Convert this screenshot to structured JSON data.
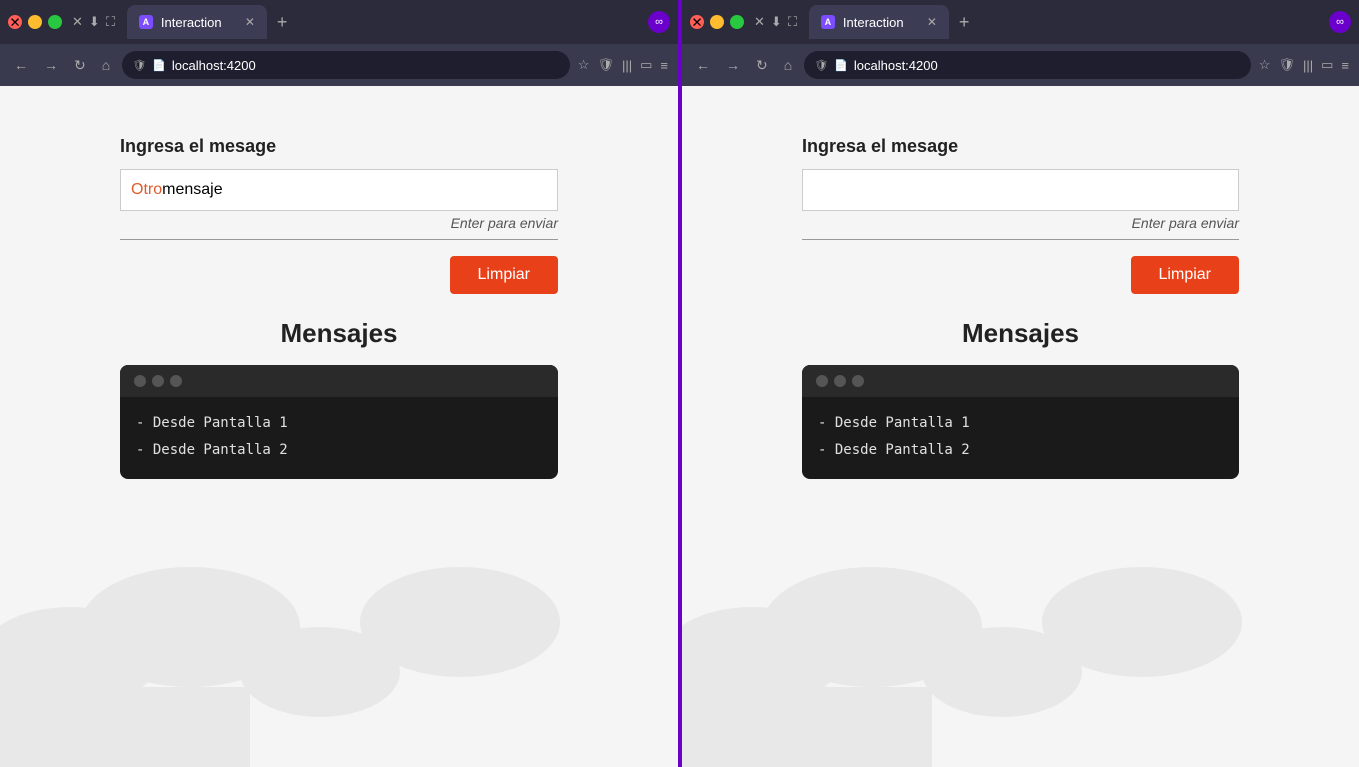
{
  "browser1": {
    "tab_title": "Interaction",
    "url": "localhost:4200",
    "form_label": "Ingresa el mesage",
    "input_value_colored": "Otro",
    "input_value_rest": " mensaje",
    "enter_hint": "Enter para enviar",
    "clear_button": "Limpiar",
    "mensajes_title": "Mensajes",
    "messages": [
      "- Desde Pantalla 1",
      "- Desde Pantalla 2"
    ]
  },
  "browser2": {
    "tab_title": "Interaction",
    "url": "localhost:4200",
    "form_label": "Ingresa el mesage",
    "input_value": "",
    "enter_hint": "Enter para enviar",
    "clear_button": "Limpiar",
    "mensajes_title": "Mensajes",
    "messages": [
      "- Desde Pantalla 1",
      "- Desde Pantalla 2"
    ]
  }
}
